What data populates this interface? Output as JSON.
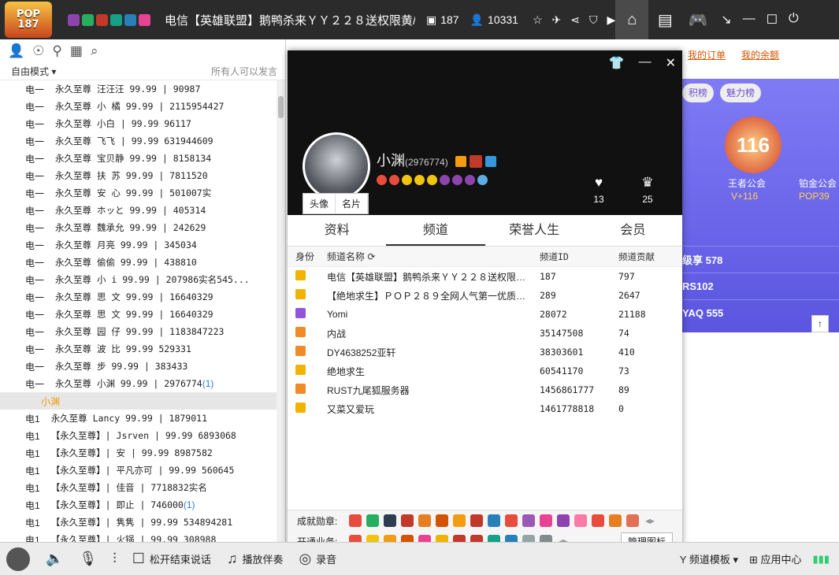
{
  "titlebar": {
    "logo_line1": "POP",
    "logo_line2": "187",
    "channel_title": "电信【英雄联盟】鹅鸭杀来ＹＹ２２８送权限黄/...",
    "channel_id": "187",
    "online": "10331"
  },
  "leftpanel": {
    "mode": "自由模式",
    "hint": "所有人可以发言",
    "users": [
      {
        "pref": "电一",
        "text": "永久至尊   汪汪汪   99.99 | 90987"
      },
      {
        "pref": "电一",
        "text": "永久至尊   小 橘   99.99 | 2115954427"
      },
      {
        "pref": "电一",
        "text": "永久至尊   小白    | 99.99    96117"
      },
      {
        "pref": "电一",
        "text": "永久至尊   飞飞   | 99.99 631944609"
      },
      {
        "pref": "电一",
        "text": "永久至尊   宝贝静   99.99 | 8158134"
      },
      {
        "pref": "电一",
        "text": "永久至尊   扶 苏   99.99 | 7811520"
      },
      {
        "pref": "电一",
        "text": "永久至尊   安 心   99.99 | 501007实"
      },
      {
        "pref": "电一",
        "text": "永久至尊   ホッと   99.99 | 405314"
      },
      {
        "pref": "电一",
        "text": "永久至尊   魏承允   99.99 | 242629"
      },
      {
        "pref": "电一",
        "text": "永久至尊   月亮   99.99 | 345034"
      },
      {
        "pref": "电一",
        "text": "永久至尊   偷偷  99.99 | 438810"
      },
      {
        "pref": "电一",
        "text": "永久至尊   小 i  99.99 | 207986实名545..."
      },
      {
        "pref": "电一",
        "text": "永久至尊   思 文   99.99 | 16640329"
      },
      {
        "pref": "电一",
        "text": "永久至尊   思 文   99.99 | 16640329"
      },
      {
        "pref": "电一",
        "text": "永久至尊   园 仔 99.99 | 1183847223"
      },
      {
        "pref": "电一",
        "text": "永久至尊   波 比  99.99 529331"
      },
      {
        "pref": "电一",
        "text": "永久至尊     步    99.99 | 383433"
      },
      {
        "pref": "电一",
        "text": "永久至尊   小渊    99.99 | 2976774",
        "extra": "(1)"
      },
      {
        "pref": "",
        "text": "小渊",
        "self": true
      },
      {
        "pref": "电1",
        "text": "永久至尊   Lancy   99.99  | 1879011"
      },
      {
        "pref": "电1",
        "text": "【永久至尊】| Jsrven | 99.99 6893068"
      },
      {
        "pref": "电1",
        "text": "【永久至尊】| 安 | 99.99  8987582"
      },
      {
        "pref": "电1",
        "text": "【永久至尊】| 平凡亦可 | 99.99  560645"
      },
      {
        "pref": "电1",
        "text": "【永久至尊】|    佳音     | 7718832实名"
      },
      {
        "pref": "电1",
        "text": "【永久至尊】|    即止    | 746000",
        "extra": "(1)"
      },
      {
        "pref": "电1",
        "text": "【永久至尊】| 隽隽 |  99.99  534894281"
      },
      {
        "pref": "电1",
        "text": "【永久至尊】| 火锅 | 99.99 308988"
      }
    ]
  },
  "rightbg": {
    "link1": "我的订单",
    "link2": "我的余额",
    "tab1": "积榜",
    "tab2": "魅力榜",
    "vbadge_top": "V+",
    "vbadge_num": "116",
    "vbadge_sub": "王者公会",
    "vbadge_label": "V+116",
    "side_sub": "铂金公会",
    "side_num": "POP39",
    "rank1": "级享 578",
    "rank2": "RS102",
    "rank3": "YAQ 555"
  },
  "popup": {
    "name": "小渊",
    "uid": "(2976774)",
    "likes": "13",
    "fans": "25",
    "btn_avatar": "头像",
    "btn_card": "名片",
    "tabs": [
      "资料",
      "频道",
      "荣誉人生",
      "会员"
    ],
    "table_head": {
      "c1": "身份",
      "c2": "频道名称",
      "c3": "频道ID",
      "c4": "频道贡献"
    },
    "rows": [
      {
        "name": "电信【英雄联盟】鹅鸭杀来ＹＹ２２８送权限…",
        "id": "187",
        "contrib": "797",
        "g": "gold"
      },
      {
        "name": "【绝地求生】ＰＯＰ２８９全网人气第一优质…",
        "id": "289",
        "contrib": "2647",
        "g": "gold"
      },
      {
        "name": "Yomi",
        "id": "28072",
        "contrib": "21188",
        "g": "pur"
      },
      {
        "name": "内战",
        "id": "35147508",
        "contrib": "74",
        "g": "org"
      },
      {
        "name": "   DY4638252亚轩",
        "id": "38303601",
        "contrib": "410",
        "g": "org"
      },
      {
        "name": "绝地求生",
        "id": "60541170",
        "contrib": "73",
        "g": "gold"
      },
      {
        "name": "RUST九尾狐服务器",
        "id": "1456861777",
        "contrib": "89",
        "g": "org"
      },
      {
        "name": "又菜又爱玩",
        "id": "1461778818",
        "contrib": "0",
        "g": "gold"
      }
    ],
    "foot_label1": "成就勋章:",
    "foot_label2": "开通业务:",
    "manage_btn": "管理图标"
  },
  "bottombar": {
    "release": "松开结束说话",
    "accompany": "播放伴奏",
    "record": "录音",
    "template": "频道模板",
    "app_center": "应用中心"
  }
}
